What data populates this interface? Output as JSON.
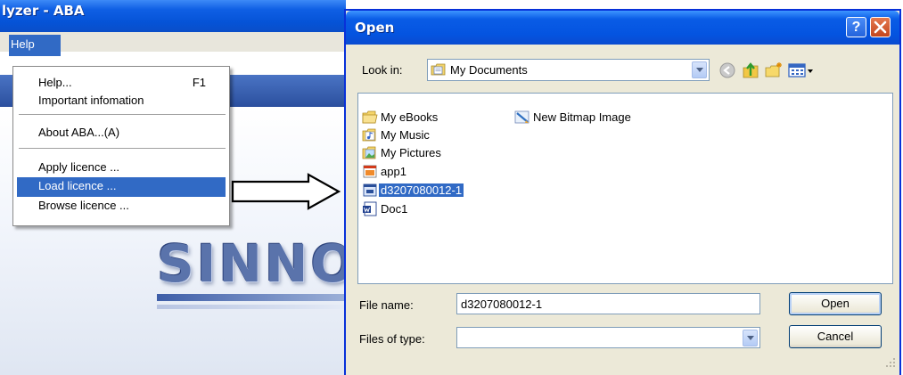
{
  "app": {
    "title": "lyzer - ABA",
    "menu_help": "Help",
    "logo_text": "SINNO",
    "help_menu": {
      "items": [
        {
          "label": "Help...",
          "shortcut": "F1"
        },
        {
          "label": "Important infomation",
          "shortcut": ""
        },
        {
          "label": "About ABA...(A)",
          "shortcut": ""
        },
        {
          "label": "Apply licence ...",
          "shortcut": ""
        },
        {
          "label": "Load licence ...",
          "shortcut": "",
          "selected": true
        },
        {
          "label": "Browse licence ...",
          "shortcut": ""
        }
      ]
    }
  },
  "dialog": {
    "title": "Open",
    "help_button": "?",
    "close_button": "X",
    "look_in_label": "Look in:",
    "look_in_value": "My Documents",
    "toolbar_icons": [
      "back-icon",
      "up-folder-icon",
      "new-folder-icon",
      "views-menu-icon"
    ],
    "files": [
      {
        "name": "My eBooks",
        "icon": "folder-icon"
      },
      {
        "name": "My Music",
        "icon": "music-folder-icon"
      },
      {
        "name": "My Pictures",
        "icon": "pictures-folder-icon"
      },
      {
        "name": "app1",
        "icon": "app-file-icon"
      },
      {
        "name": "d3207080012-1",
        "icon": "data-file-icon",
        "selected": true
      },
      {
        "name": "Doc1",
        "icon": "word-document-icon"
      },
      {
        "name": "New Bitmap Image",
        "icon": "bitmap-image-icon"
      }
    ],
    "file_name_label": "File name:",
    "file_name_value": "d3207080012-1",
    "file_type_label": "Files of type:",
    "file_type_value": "",
    "open_button": "Open",
    "cancel_button": "Cancel"
  },
  "colors": {
    "xp_title_blue": "#0553d7",
    "selection_blue": "#316ac5",
    "dialog_face": "#ece9d8",
    "close_red": "#c4461d"
  }
}
